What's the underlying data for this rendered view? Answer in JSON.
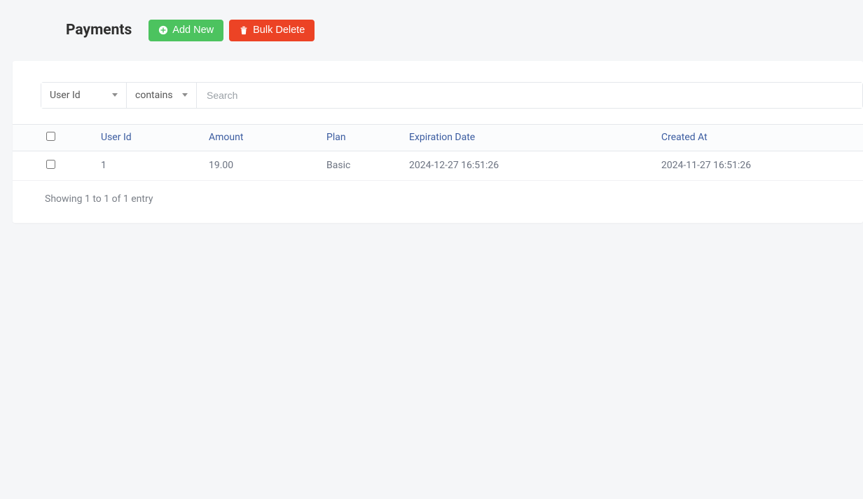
{
  "header": {
    "title": "Payments",
    "add_label": "Add New",
    "bulk_delete_label": "Bulk Delete"
  },
  "filter": {
    "field": "User Id",
    "operator": "contains",
    "search_placeholder": "Search"
  },
  "table": {
    "columns": [
      "User Id",
      "Amount",
      "Plan",
      "Expiration Date",
      "Created At"
    ],
    "rows": [
      {
        "user_id": "1",
        "amount": "19.00",
        "plan": "Basic",
        "expiration": "2024-12-27 16:51:26",
        "created": "2024-11-27 16:51:26"
      }
    ],
    "footer": "Showing 1 to 1 of 1 entry"
  }
}
